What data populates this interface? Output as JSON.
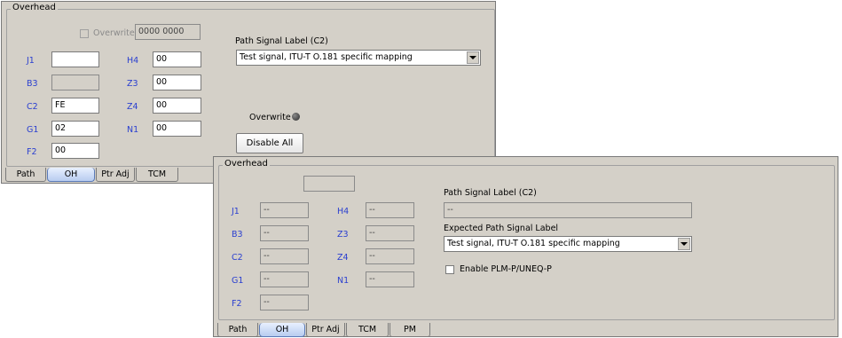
{
  "panel_a": {
    "group_title": "Overhead",
    "overwrite_label": "Overwrite",
    "overwrite_value": "0000 0000",
    "fields": {
      "j1": {
        "label": "J1",
        "value": ""
      },
      "b3": {
        "label": "B3",
        "value": ""
      },
      "c2": {
        "label": "C2",
        "value": "FE"
      },
      "g1": {
        "label": "G1",
        "value": "02"
      },
      "f2": {
        "label": "F2",
        "value": "00"
      },
      "h4": {
        "label": "H4",
        "value": "00"
      },
      "z3": {
        "label": "Z3",
        "value": "00"
      },
      "z4": {
        "label": "Z4",
        "value": "00"
      },
      "n1": {
        "label": "N1",
        "value": "00"
      }
    },
    "path_signal_label_title": "Path Signal Label (C2)",
    "path_signal_label_value": "Test signal, ITU-T O.181 specific mapping",
    "overwrite_led_label": "Overwrite",
    "disable_all_label": "Disable All",
    "tabs": [
      "Path",
      "OH",
      "Ptr Adj",
      "TCM"
    ],
    "active_tab": "OH"
  },
  "panel_b": {
    "group_title": "Overhead",
    "top_field_value": "",
    "fields": {
      "j1": {
        "label": "J1",
        "value": "--"
      },
      "b3": {
        "label": "B3",
        "value": "--"
      },
      "c2": {
        "label": "C2",
        "value": "--"
      },
      "g1": {
        "label": "G1",
        "value": "--"
      },
      "f2": {
        "label": "F2",
        "value": "--"
      },
      "h4": {
        "label": "H4",
        "value": "--"
      },
      "z3": {
        "label": "Z3",
        "value": "--"
      },
      "z4": {
        "label": "Z4",
        "value": "--"
      },
      "n1": {
        "label": "N1",
        "value": "--"
      }
    },
    "path_signal_label_title": "Path Signal Label (C2)",
    "path_signal_label_value": "--",
    "expected_label_title": "Expected Path Signal Label",
    "expected_label_value": "Test signal, ITU-T O.181 specific mapping",
    "enable_plm_label": "Enable PLM-P/UNEQ-P",
    "tabs": [
      "Path",
      "OH",
      "Ptr Adj",
      "TCM",
      "PM"
    ],
    "active_tab": "OH"
  },
  "colors": {
    "panel_bg": "#d4d0c8",
    "field_label_blue": "#2a3fd0",
    "active_tab": "#b8ccf0"
  },
  "icons": [
    "dropdown-arrow-icon",
    "led-indicator-icon",
    "checkbox-icon"
  ]
}
